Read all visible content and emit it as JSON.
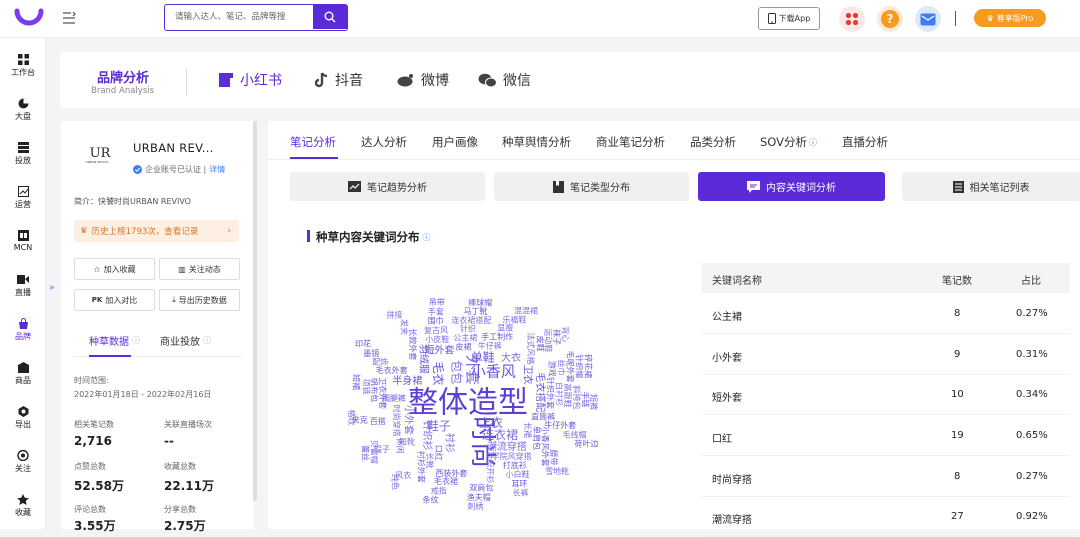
{
  "topbar": {
    "search_placeholder": "请输入达人、笔记、品牌等搜",
    "download_app": "下载App",
    "pro_label": "尊享版Pro",
    "colors": {
      "accent": "#5b2bd8",
      "pro": "#f59b1f"
    }
  },
  "sidebar": {
    "items": [
      {
        "label": "工作台",
        "icon": "grid-icon"
      },
      {
        "label": "大盘",
        "icon": "pie-icon"
      },
      {
        "label": "投放",
        "icon": "layers-icon"
      },
      {
        "label": "运营",
        "icon": "chart-icon"
      },
      {
        "label": "MCN",
        "icon": "mcn-icon"
      },
      {
        "label": "直播",
        "icon": "video-icon"
      },
      {
        "label": "品牌",
        "icon": "bag-icon"
      },
      {
        "label": "商品",
        "icon": "goods-icon"
      },
      {
        "label": "导出",
        "icon": "export-icon"
      },
      {
        "label": "关注",
        "icon": "eye-icon"
      },
      {
        "label": "收藏",
        "icon": "star-icon"
      }
    ],
    "active": "品牌"
  },
  "brand_header": {
    "title": "品牌分析",
    "subtitle": "Brand Analysis",
    "platforms": [
      "小红书",
      "抖音",
      "微博",
      "微信"
    ]
  },
  "left_panel": {
    "brand_name": "URBAN REV...",
    "logo_text": "UR",
    "logo_sub": "URBAN REVIVO",
    "verify": "企业账号已认证 |",
    "verify_detail": "详情",
    "intro": "简介：快饕时尚URBAN REVIVO",
    "rank": "历史上榜1793次，查看记录",
    "buttons": [
      "加入收藏",
      "关注动态",
      "加入对比",
      "导出历史数据"
    ],
    "tabs": [
      "种草数据",
      "商业投放"
    ],
    "time_label": "时间范围:",
    "time_value": "2022年01月18日 - 2022年02月16日",
    "stats": [
      {
        "label": "相关笔记数",
        "value": "2,716"
      },
      {
        "label": "关联直播场次",
        "value": "--"
      },
      {
        "label": "点赞总数",
        "value": "52.58万"
      },
      {
        "label": "收藏总数",
        "value": "22.11万"
      },
      {
        "label": "评论总数",
        "value": "3.55万"
      },
      {
        "label": "分享总数",
        "value": "2.75万"
      }
    ]
  },
  "main": {
    "tabs": [
      "笔记分析",
      "达人分析",
      "用户画像",
      "种草舆情分析",
      "商业笔记分析",
      "品类分析",
      "SOV分析",
      "直播分析"
    ],
    "subtabs": [
      "笔记趋势分析",
      "笔记类型分布",
      "内容关键词分析",
      "相关笔记列表"
    ],
    "section_title": "种草内容关键词分布",
    "table": {
      "headers": [
        "关键词名称",
        "笔记数",
        "占比"
      ],
      "rows": [
        {
          "name": "公主裙",
          "count": "8",
          "pct": "0.27%"
        },
        {
          "name": "小外套",
          "count": "9",
          "pct": "0.31%"
        },
        {
          "name": "短外套",
          "count": "10",
          "pct": "0.34%"
        },
        {
          "name": "口红",
          "count": "19",
          "pct": "0.65%"
        },
        {
          "name": "时尚穿搭",
          "count": "8",
          "pct": "0.27%"
        },
        {
          "name": "潮流穿搭",
          "count": "27",
          "pct": "0.92%"
        }
      ]
    },
    "word_cloud": [
      "整体造型",
      "时尚",
      "外套",
      "小香风",
      "包包",
      "上衣",
      "鞋子",
      "毛衣",
      "连衣裙",
      "单鞋",
      "衬衫",
      "半身裙",
      "针织衫",
      "毛衣搭配",
      "潮流穿搭",
      "短外套",
      "小外套",
      "羽绒服",
      "大衣",
      "卫衣",
      "牛仔裤",
      "阔腿裤",
      "长裙",
      "皮裙",
      "公主裙",
      "口红",
      "学院风穿搭",
      "针织外套",
      "时尚穿搭",
      "直筒裤",
      "小皮鞋",
      "单肩包",
      "针织开衫",
      "手工制作",
      "法式风格",
      "毛衣外套",
      "短靴",
      "小香风外套",
      "针织",
      "西装外套",
      "白衬衫",
      "打底衫",
      "长靴",
      "游戏",
      "复古风",
      "百搭",
      "休闲",
      "卫衣外套",
      "显瘦",
      "长款外套",
      "连衣裙搭配",
      "牛仔外套",
      "高跟鞋",
      "毛衣裙",
      "配饰",
      "衬衫外套",
      "小白鞋",
      "皮鞋",
      "丝巾",
      "围巾",
      "帽子",
      "帆布包",
      "斜挎包",
      "双肩包",
      "运动鞋",
      "马丁靴",
      "乐福鞋",
      "毛呢外套",
      "风衣",
      "夹克",
      "腰带",
      "耳环",
      "项链",
      "手链",
      "戒指",
      "墨镜",
      "发夹",
      "袜子",
      "手套",
      "针织帽",
      "毛线帽",
      "渔夫帽",
      "贝雷帽",
      "棒球帽",
      "雪地靴",
      "短裙",
      "长裤",
      "短裤",
      "背心",
      "吊带",
      "混混裙",
      "碎花裙",
      "格纹",
      "条纹",
      "纯色",
      "印花",
      "刺绣",
      "蕾丝",
      "拼接",
      "荷叶边"
    ]
  }
}
